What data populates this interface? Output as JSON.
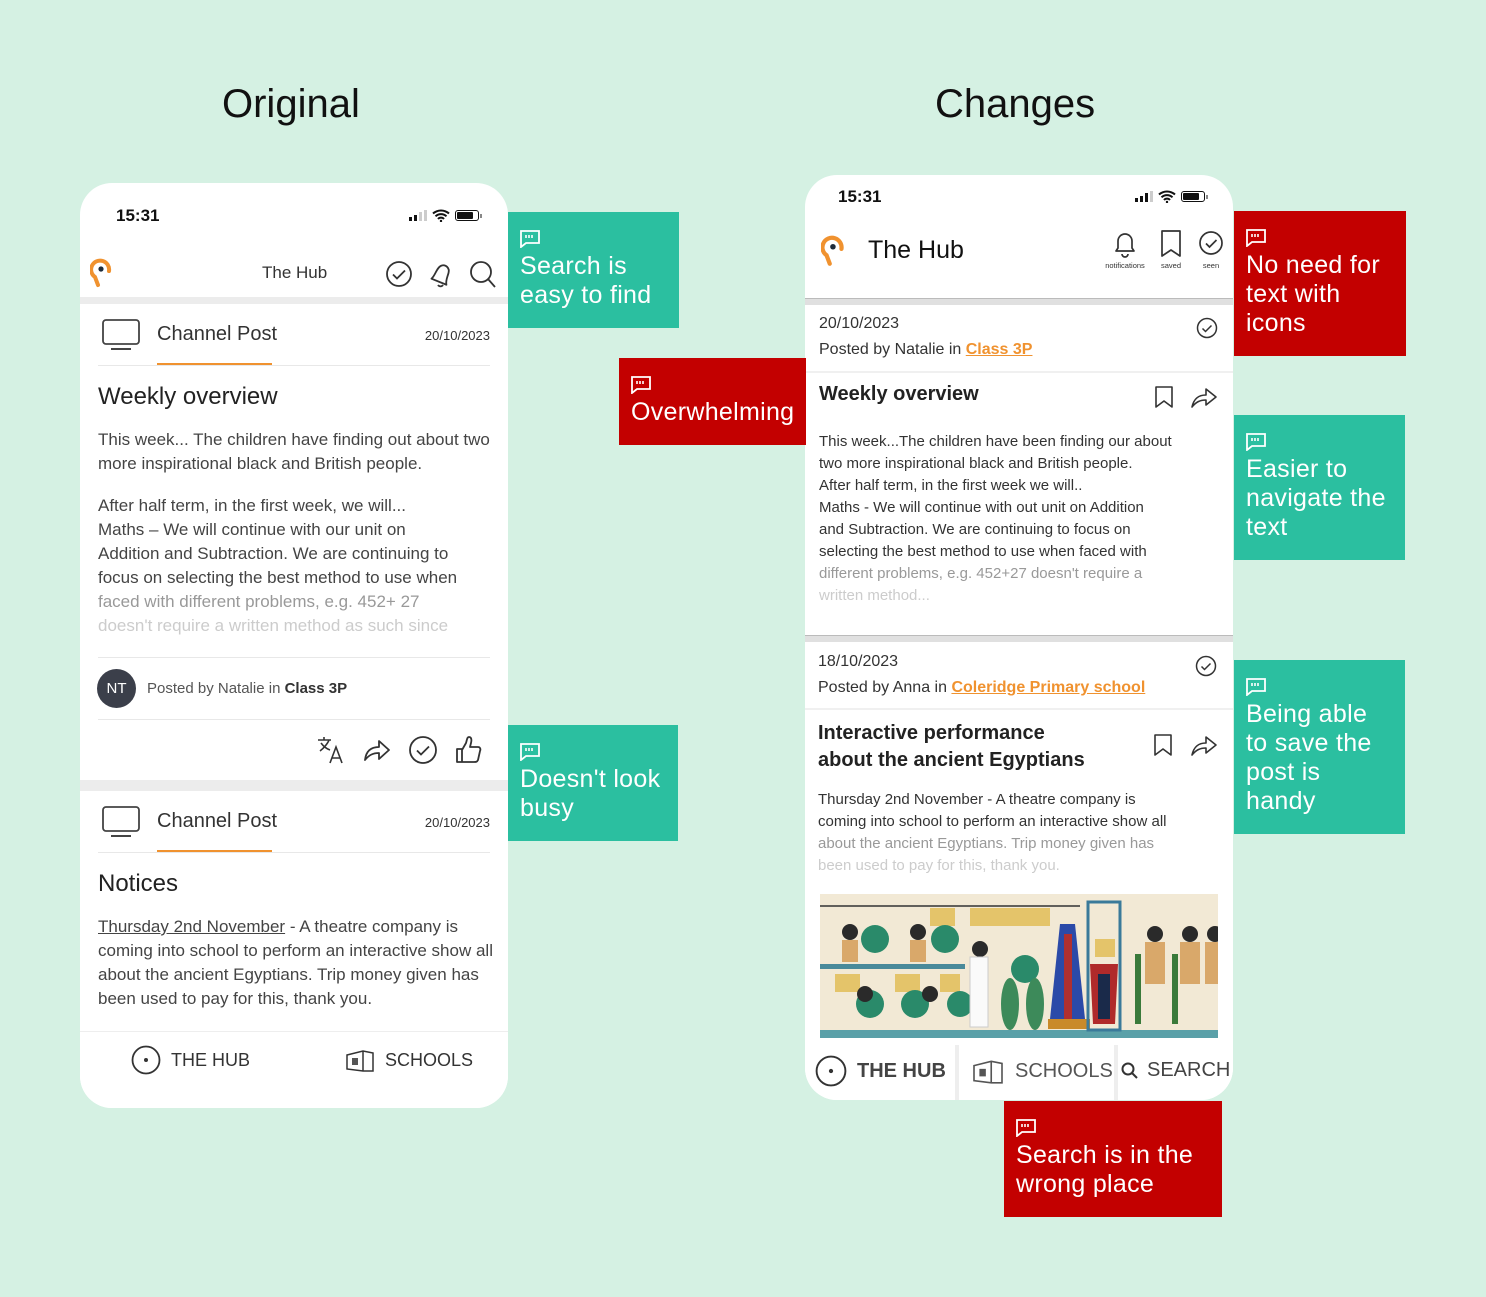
{
  "headings": {
    "original": "Original",
    "changes": "Changes"
  },
  "original": {
    "status_time": "15:31",
    "app_title": "The Hub",
    "posts": [
      {
        "type": "Channel Post",
        "date": "20/10/2023",
        "title": "Weekly overview",
        "para1": "This week... The children have finding out about two more inspirational black and British people.",
        "para2_lines": [
          "After half term, in the first week, we will...",
          "Maths – We will continue with our unit on",
          "Addition and Subtraction. We are continuing to",
          "focus on selecting the best method to use when",
          "faced with different problems, e.g. 452+ 27",
          "doesn't require a written method as such since"
        ],
        "avatar_initials": "NT",
        "posted_by": "Posted by Natalie in ",
        "channel": "Class 3P"
      },
      {
        "type": "Channel Post",
        "date": "20/10/2023",
        "title": "Notices",
        "body_link": "Thursday 2nd November",
        "body": " - A theatre company is coming into school to perform an interactive show all about the ancient Egyptians. Trip money given has been used to pay for this, thank you."
      }
    ],
    "nav": [
      {
        "label": "THE HUB",
        "icon": "hub-icon"
      },
      {
        "label": "SCHOOLS",
        "icon": "schools-icon"
      }
    ]
  },
  "changes": {
    "status_time": "15:31",
    "app_title": "The Hub",
    "header_actions": [
      {
        "label": "notifications",
        "icon": "bell-icon"
      },
      {
        "label": "saved",
        "icon": "bookmark-icon"
      },
      {
        "label": "seen",
        "icon": "check-circle-icon"
      }
    ],
    "posts": [
      {
        "date": "20/10/2023",
        "posted_by": "Posted by Natalie in ",
        "channel": "Class 3P",
        "title": "Weekly overview",
        "lines": [
          "This week...The children have been finding our about",
          "two more inspirational black and British people.",
          "After half term, in the first week we will..",
          "Maths - We will continue with out unit on Addition",
          "and Subtraction. We are continuing to focus on",
          "selecting the best method to use when faced with",
          "different problems, e.g. 452+27 doesn't require a",
          "written method..."
        ]
      },
      {
        "date": "18/10/2023",
        "posted_by": "Posted by Anna in ",
        "channel": "Coleridge Primary school",
        "title_line1": "Interactive performance",
        "title_line2": "about the ancient Egyptians",
        "lines": [
          "Thursday 2nd November - A theatre company is",
          "coming into school to perform an interactive show all",
          "about the ancient Egyptians. Trip money given has",
          "been used to pay for this, thank you."
        ],
        "image_alt": "Ancient Egyptian wall painting"
      }
    ],
    "nav": [
      {
        "label": "THE HUB",
        "icon": "hub-icon"
      },
      {
        "label": "SCHOOLS",
        "icon": "schools-icon"
      },
      {
        "label": "SEARCH",
        "icon": "search-icon"
      }
    ]
  },
  "notes": [
    {
      "text": "Search is easy to find",
      "sentiment": "positive"
    },
    {
      "text": "Overwhelming",
      "sentiment": "negative"
    },
    {
      "text": "Doesn't look busy",
      "sentiment": "positive"
    },
    {
      "text": "No need for text with icons",
      "sentiment": "negative"
    },
    {
      "text": "Easier to navigate the text",
      "sentiment": "positive"
    },
    {
      "text": "Being able to save the post is handy",
      "sentiment": "positive"
    },
    {
      "text": "Search is in the wrong place",
      "sentiment": "negative"
    }
  ],
  "colors": {
    "accent_orange": "#f0922f",
    "note_green": "#2bbfa0",
    "note_red": "#c30000",
    "background": "#d5f1e3"
  }
}
